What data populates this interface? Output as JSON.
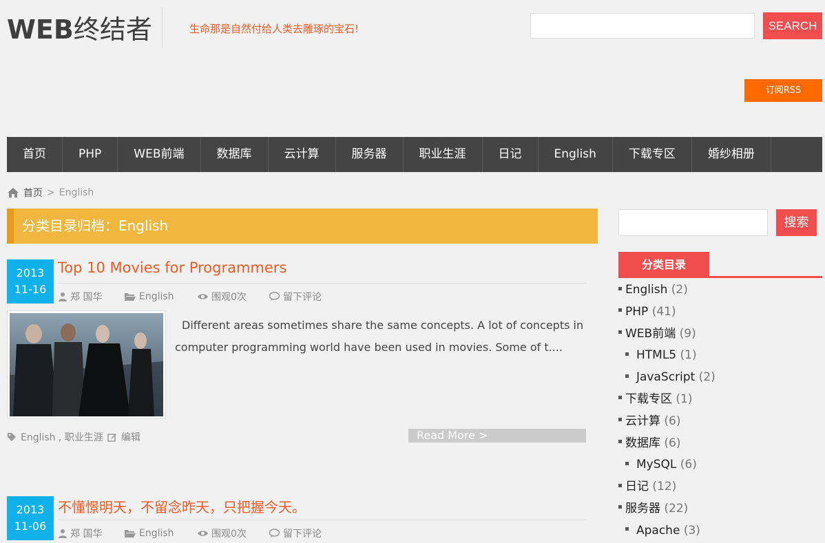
{
  "header": {
    "logo_bold": "WEB",
    "logo_rest": "终结者",
    "tagline": "生命那是自然付给人类去雕琢的宝石!",
    "search_placeholder": "",
    "search_button": "SEARCH",
    "rss_button": "订阅RSS"
  },
  "nav": {
    "items": [
      "首页",
      "PHP",
      "WEB前端",
      "数据库",
      "云计算",
      "服务器",
      "职业生涯",
      "日记",
      "English",
      "下载专区",
      "婚纱相册"
    ]
  },
  "breadcrumb": {
    "home": "首页",
    "separator": ">",
    "current": "English"
  },
  "archive": {
    "title": "分类目录归档：English"
  },
  "posts": [
    {
      "year": "2013",
      "date": "11-16",
      "title": "Top 10 Movies for Programmers",
      "author": "郑 国华",
      "category": "English",
      "views": "围观0次",
      "comment": "留下评论",
      "excerpt": "Different areas sometimes share the same concepts. A lot of concepts in computer programming world have been used in movies. Some of t....",
      "tags": "English , 职业生涯",
      "edit": "编辑",
      "read_more": "Read More >"
    },
    {
      "year": "2013",
      "date": "11-06",
      "title": "不懂憬明天，不留念昨天，只把握今天。",
      "author": "郑 国华",
      "category": "English",
      "views": "围观0次",
      "comment": "留下评论"
    }
  ],
  "sidebar": {
    "search_button": "搜索",
    "tab_title": "分类目录",
    "categories": [
      {
        "name": "English",
        "count": "(2)",
        "sub": false
      },
      {
        "name": "PHP",
        "count": "(41)",
        "sub": false
      },
      {
        "name": "WEB前端",
        "count": "(9)",
        "sub": false
      },
      {
        "name": "HTML5",
        "count": "(1)",
        "sub": true
      },
      {
        "name": "JavaScript",
        "count": "(2)",
        "sub": true
      },
      {
        "name": "下载专区",
        "count": "(1)",
        "sub": false
      },
      {
        "name": "云计算",
        "count": "(6)",
        "sub": false
      },
      {
        "name": "数据库",
        "count": "(6)",
        "sub": false
      },
      {
        "name": "MySQL",
        "count": "(6)",
        "sub": true
      },
      {
        "name": "日记",
        "count": "(12)",
        "sub": false
      },
      {
        "name": "服务器",
        "count": "(22)",
        "sub": false
      },
      {
        "name": "Apache",
        "count": "(3)",
        "sub": true
      }
    ]
  },
  "colors": {
    "accent_red": "#f04e4e",
    "accent_orange": "#ff6a00",
    "title_orange": "#f05a24",
    "archive_yellow": "#f0b63d",
    "date_blue": "#0fb1e8",
    "nav_dark": "#444444"
  }
}
